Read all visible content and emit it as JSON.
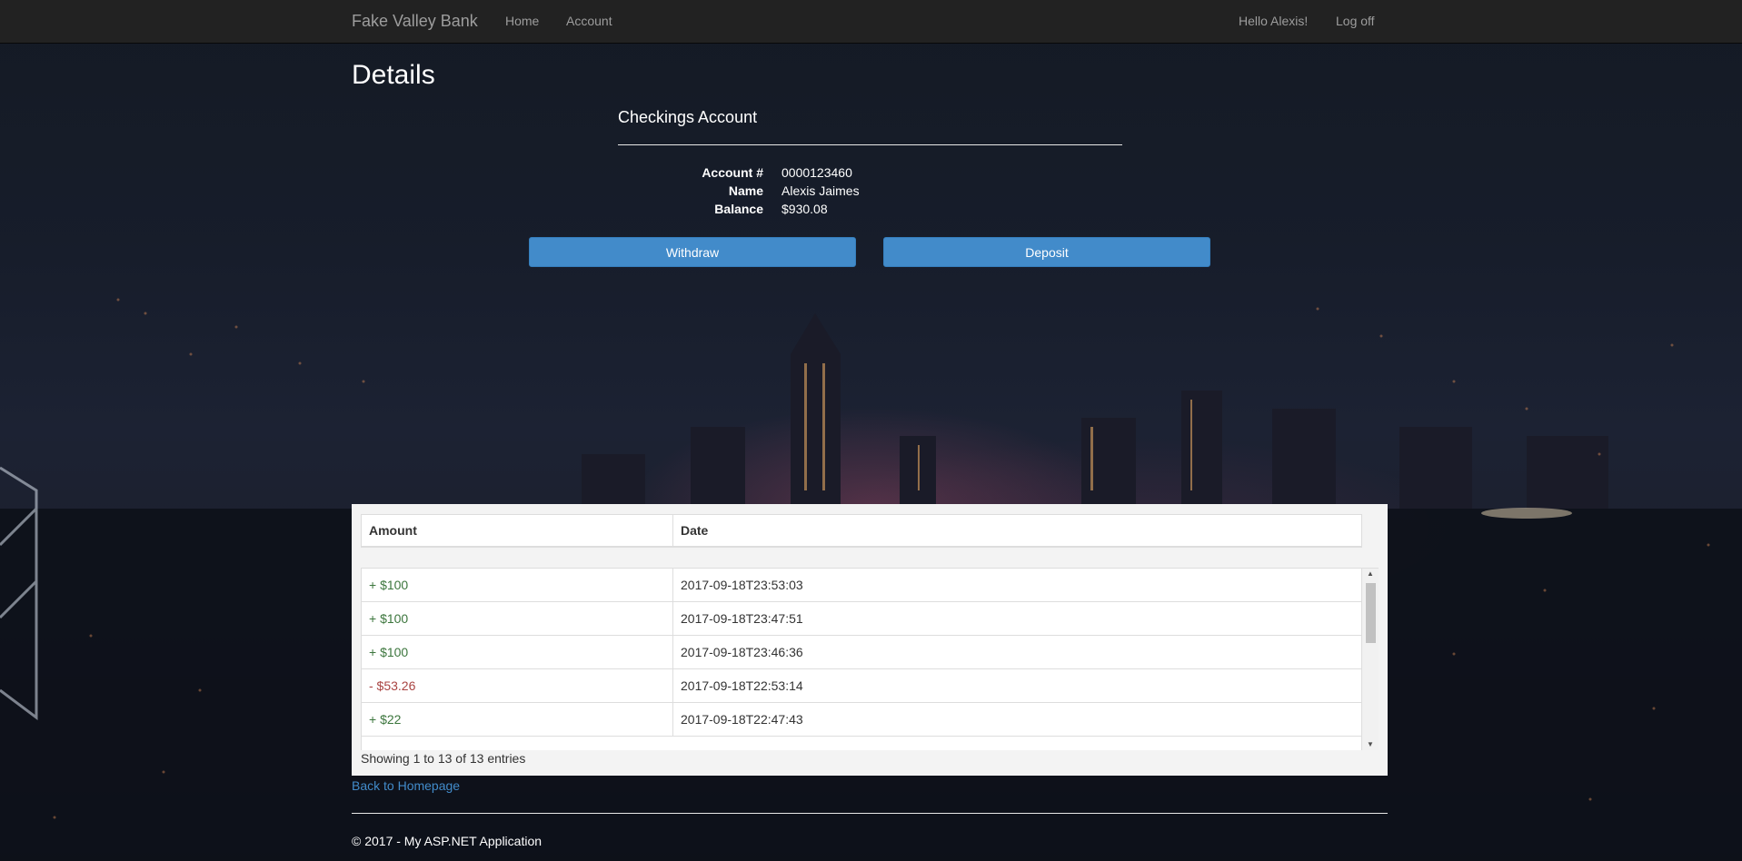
{
  "navbar": {
    "brand": "Fake Valley Bank",
    "links": [
      "Home",
      "Account"
    ],
    "greeting": "Hello Alexis!",
    "logoff": "Log off"
  },
  "page": {
    "title": "Details"
  },
  "account": {
    "heading": "Checkings Account",
    "fields": [
      {
        "label": "Account #",
        "value": "0000123460"
      },
      {
        "label": "Name",
        "value": "Alexis Jaimes"
      },
      {
        "label": "Balance",
        "value": "$930.08"
      }
    ]
  },
  "actions": {
    "withdraw": "Withdraw",
    "deposit": "Deposit"
  },
  "transactions": {
    "columns": [
      "Amount",
      "Date"
    ],
    "rows": [
      {
        "amount": "+ $100",
        "date": "2017-09-18T23:53:03",
        "type": "positive"
      },
      {
        "amount": "+ $100",
        "date": "2017-09-18T23:47:51",
        "type": "positive"
      },
      {
        "amount": "+ $100",
        "date": "2017-09-18T23:46:36",
        "type": "positive"
      },
      {
        "amount": "- $53.26",
        "date": "2017-09-18T22:53:14",
        "type": "negative"
      },
      {
        "amount": "+ $22",
        "date": "2017-09-18T22:47:43",
        "type": "positive"
      }
    ],
    "info": "Showing 1 to 13 of 13 entries"
  },
  "back_link": "Back to Homepage",
  "footer": {
    "text": "© 2017 - My ASP.NET Application"
  },
  "colors": {
    "navbar": "#222222",
    "button": "#428bca",
    "positive": "#3c763d",
    "negative": "#a94442",
    "link": "#428bca"
  },
  "icons": {
    "scroll_up": "scroll-up-arrow-icon",
    "scroll_down": "scroll-down-arrow-icon"
  }
}
